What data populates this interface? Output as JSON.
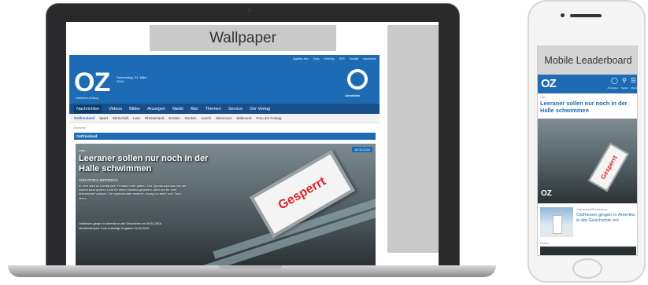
{
  "laptop": {
    "wallpaper_label": "Wallpaper",
    "site": {
      "top_links": [
        "Digitales Abo",
        "Shop",
        "Lesertrip",
        "RSS",
        "Kontakt",
        "Impressum"
      ],
      "logo": "OZ",
      "logo_sub": "Ostfriesen-Zeitung",
      "date": "Donnerstag, 31. März 2016",
      "login_label": "Anmelden",
      "main_nav": [
        "Nachrichten",
        "Videos",
        "Bilder",
        "Anzeigen",
        "Markt",
        "Abo",
        "Themen",
        "Service",
        "Der Verlag"
      ],
      "sub_nav": [
        "Ostfriesland",
        "Sport",
        "Wirtschaft",
        "Leer",
        "Rheiderland",
        "Emden",
        "Norden",
        "Aurich",
        "Wiesmoor",
        "Wittmund",
        "Frau am Freitag"
      ],
      "breadcrumb": "Startseite",
      "section_title": "Ostfriesland",
      "hero": {
        "kicker": "Leer",
        "date": "16.03.2016",
        "title": "Leeraner sollen nur noch in der Halle schwimmen",
        "author": "VON PETRA HERTERICH",
        "text": "In Leer wird es künftig kein Freibad mehr geben. Der Sportausschuss hat am Abend zwar grünes Licht für einen Neubau gegeben. Aber nur für eine überdachte Variante. Ein spektakuläre andere Lösung ist damit vom Tisch. Mehr...",
        "links": [
          "Ostfriesen gingen in Amerika in die Geschichte ein 26.02.2016",
          "Meisterkämpen: Kohl verteidigt Vorgaben 24.02.2016"
        ],
        "sign_text": "Gesperrt"
      }
    }
  },
  "phone": {
    "leaderboard_label": "Mobile Leaderboard",
    "logo": "OZ",
    "icons": [
      "user-icon",
      "search-icon",
      "menu-icon"
    ],
    "icon_labels": [
      "Anmelden",
      "Suche",
      "Menü"
    ],
    "category": "Leer",
    "title": "Leeraner sollen nur noch in der Halle schwimmen",
    "sign_text": "Gesperrt",
    "card_category": "Ostfriesland/Rheiderlang",
    "card_title": "Ostfriesen gingen in Amerika in die Geschichte ein",
    "category2": "Emden"
  }
}
